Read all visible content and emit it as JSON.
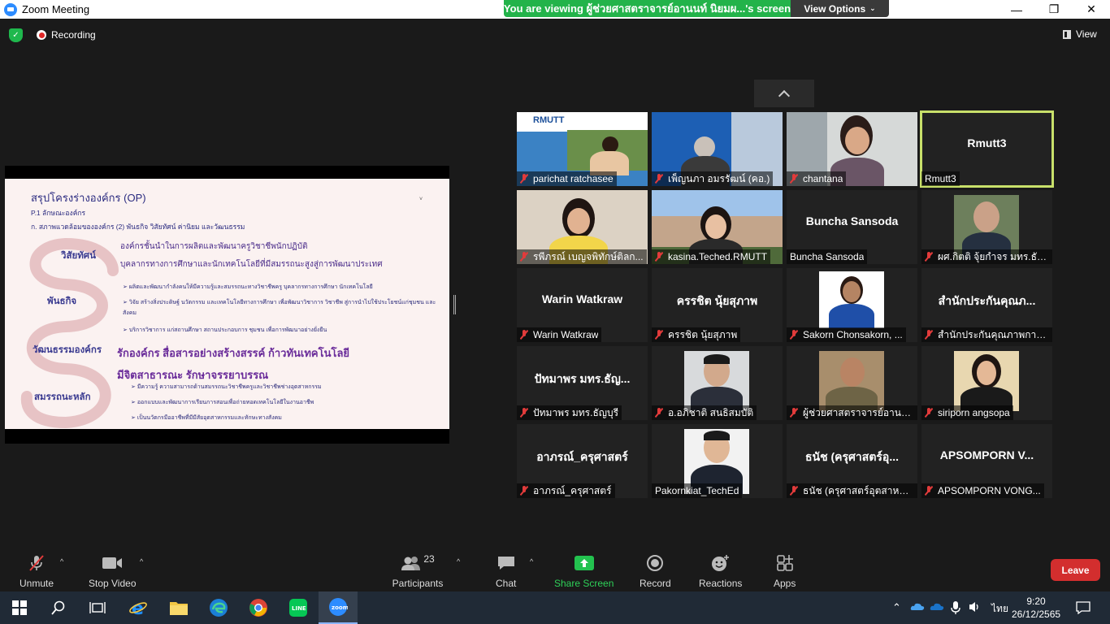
{
  "window": {
    "title": "Zoom Meeting"
  },
  "share_banner": {
    "message": "You are viewing ผู้ช่วยศาสตราจารย์อานนท์ นิยมผ...'s screen",
    "view_options": "View Options"
  },
  "overlay": {
    "recording": "Recording",
    "view": "View"
  },
  "slide": {
    "title": "สรุปโครงร่างองค์กร (OP)",
    "sub1": "P.1 ลักษณะองค์กร",
    "sub2": "ก. สภาพแวดล้อมขององค์กร (2) พันธกิจ วิสัยทัศน์ ค่านิยม และวัฒนธรรม",
    "labels": [
      "วิสัยทัศน์",
      "พันธกิจ",
      "วัฒนธรรมองค์กร",
      "สมรรถนะหลัก"
    ],
    "vision1": "องค์กรชั้นนำในการผลิตและพัฒนาครูวิชาชีพนักปฏิบัติ",
    "vision2": "บุคลากรทางการศึกษาและนักเทคโนโลยีที่มีสมรรถนะสูงสู่การพัฒนาประเทศ",
    "mission": [
      "ผลิตและพัฒนากำลังคนให้มีความรู้และสมรรถนะทางวิชาชีพครู บุคลากรทางการศึกษา นักเทคโนโลยี",
      "วิจัย สร้างสิ่งประดิษฐ์ นวัตกรรม และเทคโนโลยีทางการศึกษา เพื่อพัฒนาวิชาการ วิชาชีพ สู่การนำไปใช้ประโยชน์แก่ชุมชน และสังคม",
      "บริการวิชาการ แก่สถานศึกษา สถานประกอบการ ชุมชน เพื่อการพัฒนาอย่างยั่งยืน"
    ],
    "culture": "รักองค์กร  สื่อสารอย่างสร้างสรรค์ ก้าวทันเทคโนโลยี",
    "culture2": "มีจิตสาธารณะ  รักษาจรรยาบรรณ",
    "competency": [
      "มีความรู้ ความสามารถด้านสมรรถนะวิชาชีพครูและวิชาชีพช่างอุตสาหกรรม",
      "ออกแบบและพัฒนาการเรียนการสอนเพื่อถ่ายทอดเทคโนโลยีในงานอาชีพ",
      "เป็นนวัตกรมืออาชีพที่มีมีสัยอุตสาหกรรมและทักษะทางสังคม"
    ]
  },
  "participants_gallery": [
    {
      "name": "parichat ratchasee",
      "display": ""
    },
    {
      "name": "เพ็ญนภา  อมรรัฒน์ (คอ.)",
      "display": ""
    },
    {
      "name": "chantana",
      "display": ""
    },
    {
      "name": "Rmutt3",
      "display": "Rmutt3"
    },
    {
      "name": "รพีภรณ์ เบญจพิทักษ์ติลก...",
      "display": ""
    },
    {
      "name": "kasina.Teched.RMUTT",
      "display": ""
    },
    {
      "name": "Buncha Sansoda",
      "display": "Buncha Sansoda"
    },
    {
      "name": "ผศ.กิตติ จุ้ยกำจร มทร.ธัญบุรี",
      "display": ""
    },
    {
      "name": "Warin Watkraw",
      "display": "Warin Watkraw"
    },
    {
      "name": "ครรชิต นุ้ยสุภาพ",
      "display": "ครรชิต นุ้ยสุภาพ"
    },
    {
      "name": "Sakorn Chonsakorn, ...",
      "display": ""
    },
    {
      "name": "สำนักประกันคุณภาพการ...",
      "display": "สำนักประกันคุณภ..."
    },
    {
      "name": "ปัทมาพร มทร.ธัญบุรี",
      "display": "ปัทมาพร มทร.ธัญ..."
    },
    {
      "name": "อ.อภิชาติ สนธิสมบัติ",
      "display": ""
    },
    {
      "name": "ผู้ช่วยศาสตราจารย์อานน...",
      "display": ""
    },
    {
      "name": "siriporn angsopa",
      "display": ""
    },
    {
      "name": "อาภรณ์_ครุศาสตร์",
      "display": "อาภรณ์_ครุศาสตร์"
    },
    {
      "name": "Pakornkiat_TechEd",
      "display": ""
    },
    {
      "name": "ธนัช (ครุศาสตร์อุตสาหกร...",
      "display": "ธนัช (ครุศาสตร์อุ..."
    },
    {
      "name": "APSOMPORN VONG...",
      "display": "APSOMPORN  V..."
    }
  ],
  "toolbar": {
    "unmute": "Unmute",
    "stop_video": "Stop Video",
    "participants": "Participants",
    "participants_count": "23",
    "chat": "Chat",
    "share_screen": "Share Screen",
    "record": "Record",
    "reactions": "Reactions",
    "apps": "Apps",
    "leave": "Leave"
  },
  "taskbar": {
    "time": "9:20",
    "date": "26/12/2565",
    "lang": "ไทย"
  },
  "colors": {
    "share_green": "#23b34a",
    "leave_red": "#d32e2e",
    "active_speaker": "#c8e06a",
    "zoom_blue": "#2d8cff"
  }
}
